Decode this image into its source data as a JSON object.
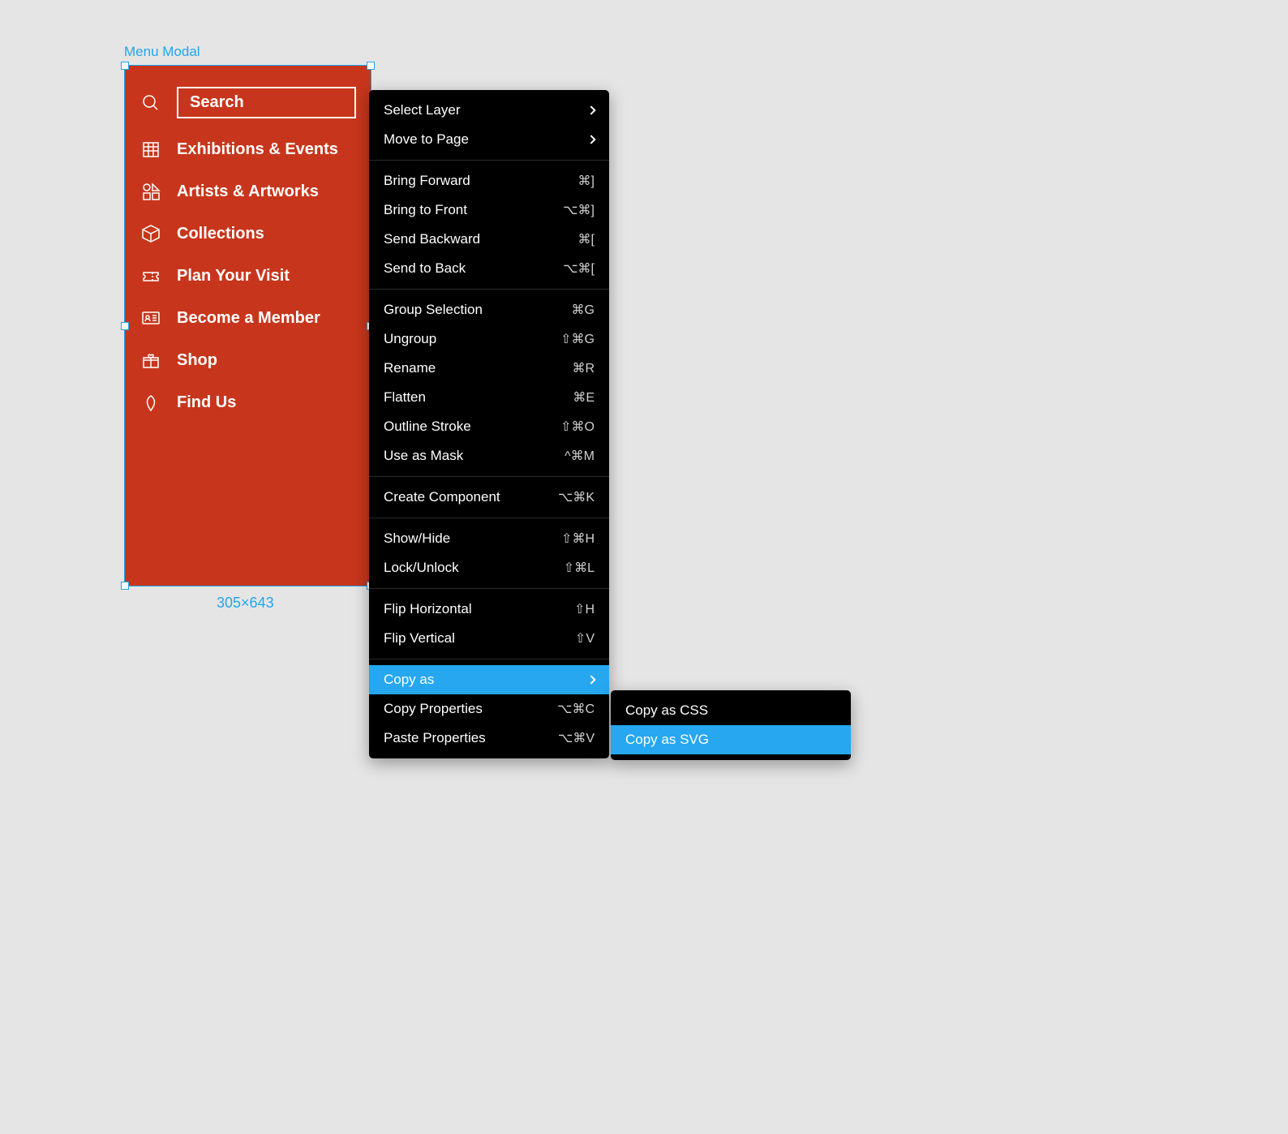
{
  "frame": {
    "label": "Menu Modal",
    "size": "305×643"
  },
  "mockup": {
    "search": "Search",
    "items": [
      "Exhibitions & Events",
      "Artists & Artworks",
      "Collections",
      "Plan Your Visit",
      "Become a Member",
      "Shop",
      "Find Us"
    ]
  },
  "context": {
    "groups": [
      [
        {
          "label": "Select Layer",
          "shortcut": "",
          "submenu": true
        },
        {
          "label": "Move to Page",
          "shortcut": "",
          "submenu": true
        }
      ],
      [
        {
          "label": "Bring Forward",
          "shortcut": "⌘]"
        },
        {
          "label": "Bring to Front",
          "shortcut": "⌥⌘]"
        },
        {
          "label": "Send Backward",
          "shortcut": "⌘["
        },
        {
          "label": "Send to Back",
          "shortcut": "⌥⌘["
        }
      ],
      [
        {
          "label": "Group Selection",
          "shortcut": "⌘G"
        },
        {
          "label": "Ungroup",
          "shortcut": "⇧⌘G"
        },
        {
          "label": "Rename",
          "shortcut": "⌘R"
        },
        {
          "label": "Flatten",
          "shortcut": "⌘E"
        },
        {
          "label": "Outline Stroke",
          "shortcut": "⇧⌘O"
        },
        {
          "label": "Use as Mask",
          "shortcut": "^⌘M"
        }
      ],
      [
        {
          "label": "Create Component",
          "shortcut": "⌥⌘K"
        }
      ],
      [
        {
          "label": "Show/Hide",
          "shortcut": "⇧⌘H"
        },
        {
          "label": "Lock/Unlock",
          "shortcut": "⇧⌘L"
        }
      ],
      [
        {
          "label": "Flip Horizontal",
          "shortcut": "⇧H"
        },
        {
          "label": "Flip Vertical",
          "shortcut": "⇧V"
        }
      ],
      [
        {
          "label": "Copy as",
          "shortcut": "",
          "submenu": true,
          "highlight": true
        },
        {
          "label": "Copy Properties",
          "shortcut": "⌥⌘C"
        },
        {
          "label": "Paste Properties",
          "shortcut": "⌥⌘V"
        }
      ]
    ]
  },
  "submenu": {
    "items": [
      {
        "label": "Copy as CSS"
      },
      {
        "label": "Copy as SVG",
        "highlight": true
      }
    ]
  }
}
